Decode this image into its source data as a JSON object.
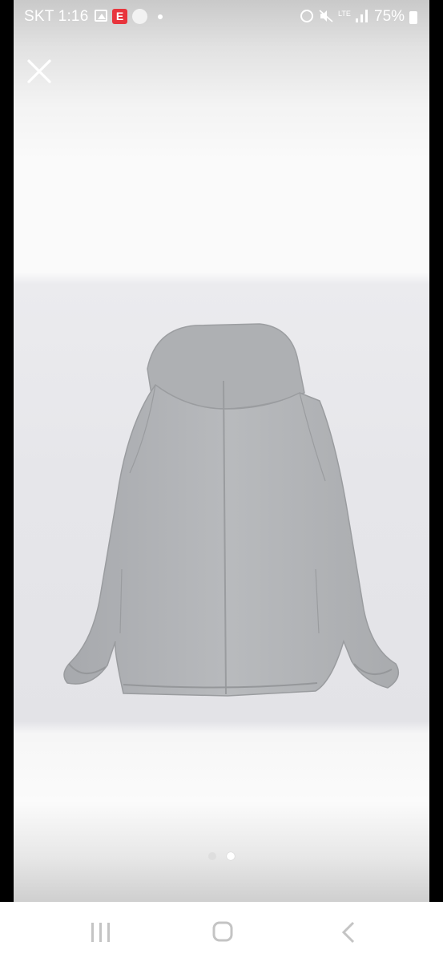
{
  "status_bar": {
    "carrier_time": "SKT 1:16",
    "network": "LTE",
    "battery": "75%",
    "icons": [
      "gallery-icon",
      "e-app-icon",
      "app-badge-icon",
      "notification-dot-icon",
      "alarm-icon",
      "mute-icon",
      "lte-icon",
      "signal-icon",
      "battery-icon"
    ]
  },
  "viewer": {
    "close_icon": "close-icon",
    "pages": {
      "count": 2,
      "current": 2
    }
  },
  "navigation_bar": {
    "buttons": [
      "recent-apps-icon",
      "home-icon",
      "back-icon"
    ]
  },
  "colors": {
    "status_text": "#ffffff",
    "nav_icon": "#c4c4c4",
    "jacket": "#b3b5b8"
  }
}
